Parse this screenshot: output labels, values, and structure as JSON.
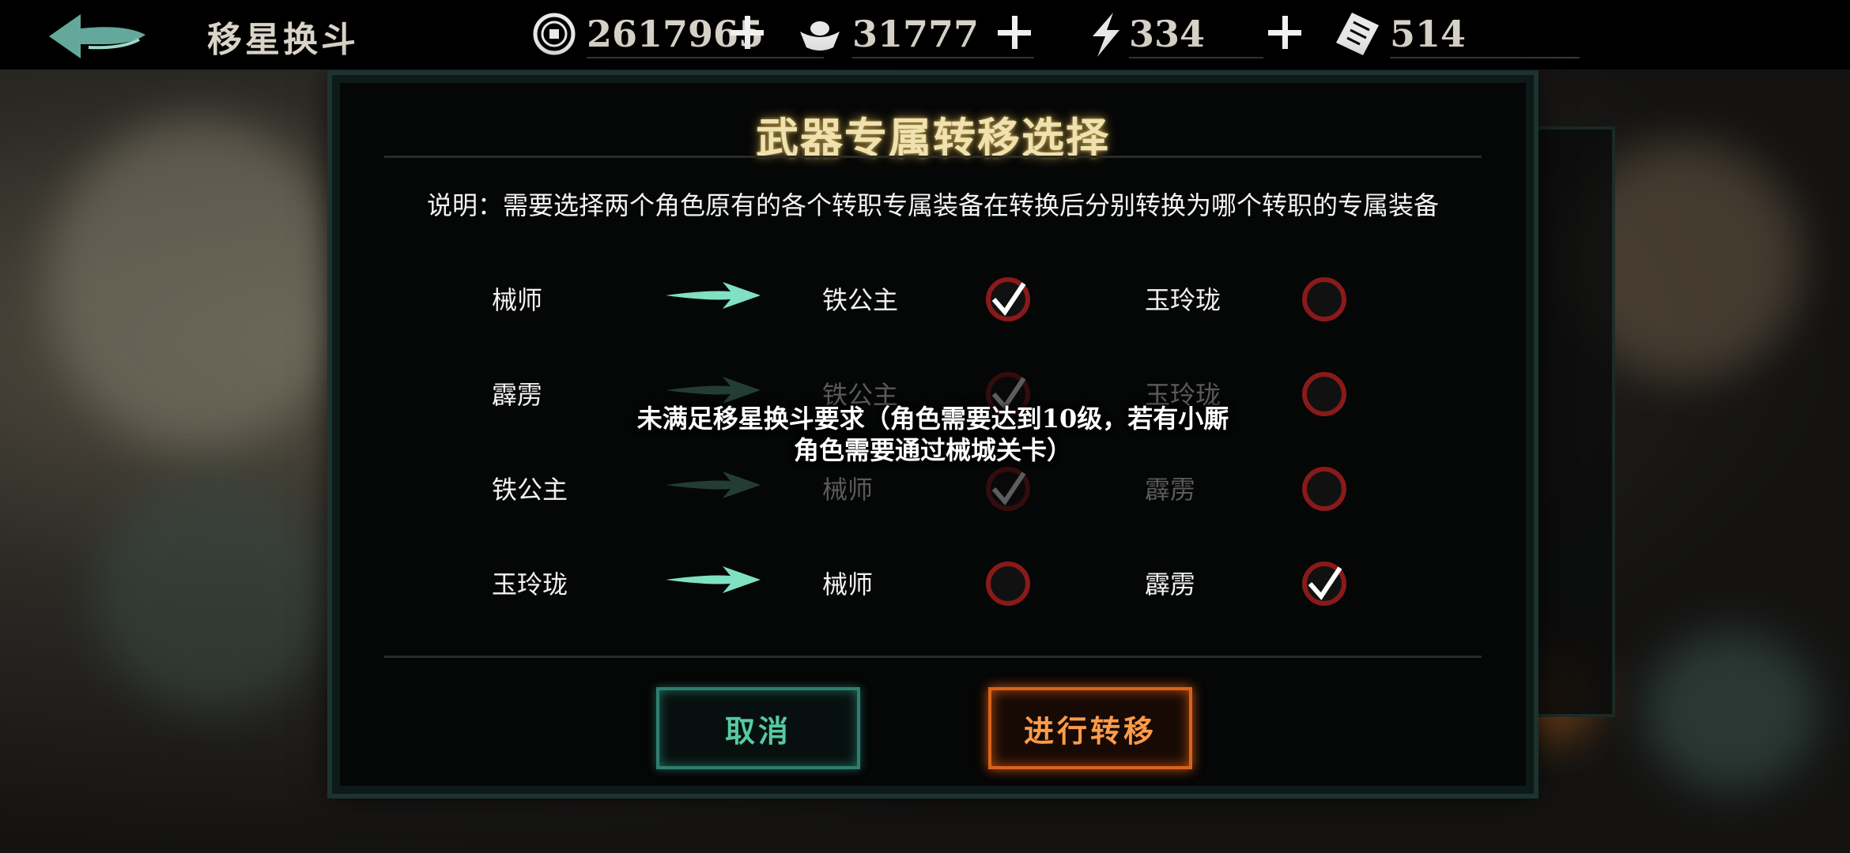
{
  "header": {
    "back_icon": "back-arrow-icon",
    "title": "移星换斗",
    "resources": [
      {
        "icon": "coin-icon",
        "value": "2617965"
      },
      {
        "icon": "ingot-icon",
        "value": "31777"
      },
      {
        "icon": "lightning-icon",
        "value": "334"
      },
      {
        "icon": "ticket-icon",
        "value": "514"
      }
    ]
  },
  "dialog": {
    "title": "武器专属转移选择",
    "description": "说明：需要选择两个角色原有的各个转职专属装备在转换后分别转换为哪个转职的专属装备",
    "rows": [
      {
        "source": "械师",
        "option_a": "铁公主",
        "option_a_selected": true,
        "option_b": "玉玲珑",
        "option_b_selected": false
      },
      {
        "source": "霹雳",
        "option_a": "铁公主",
        "option_a_selected": true,
        "option_b": "玉玲珑",
        "option_b_selected": false
      },
      {
        "source": "铁公主",
        "option_a": "械师",
        "option_a_selected": true,
        "option_b": "霹雳",
        "option_b_selected": false
      },
      {
        "source": "玉玲珑",
        "option_a": "械师",
        "option_a_selected": false,
        "option_b": "霹雳",
        "option_b_selected": true
      }
    ],
    "toast_line1": "未满足移星换斗要求（角色需要达到10级，若有小厮",
    "toast_line2": "角色需要通过械城关卡）",
    "cancel_label": "取消",
    "confirm_label": "进行转移"
  },
  "colors": {
    "accent_teal": "#57c9a2",
    "accent_orange": "#ff9b4a",
    "radio_red": "#8a1a1a",
    "title_gold": "#efe2b0"
  }
}
